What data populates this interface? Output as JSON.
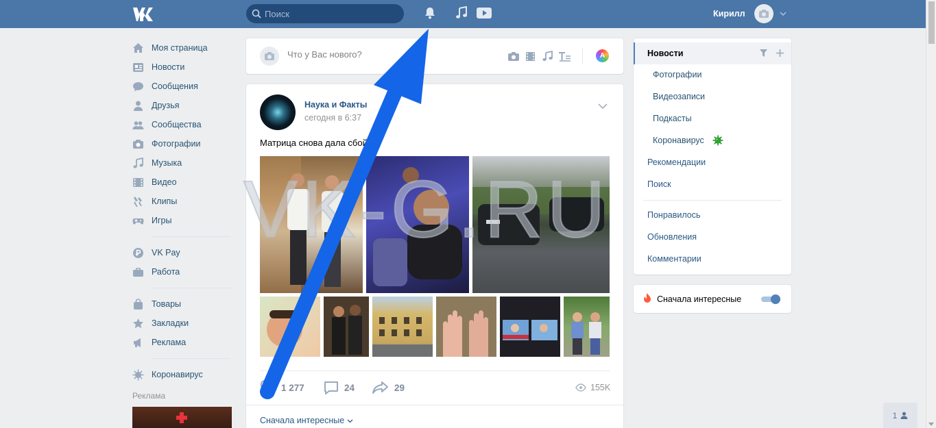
{
  "header": {
    "search_placeholder": "Поиск",
    "user_name": "Кирилл"
  },
  "leftnav": {
    "items": [
      {
        "label": "Моя страница",
        "icon": "home-icon"
      },
      {
        "label": "Новости",
        "icon": "news-icon"
      },
      {
        "label": "Сообщения",
        "icon": "messages-icon"
      },
      {
        "label": "Друзья",
        "icon": "friends-icon"
      },
      {
        "label": "Сообщества",
        "icon": "communities-icon"
      },
      {
        "label": "Фотографии",
        "icon": "photos-icon"
      },
      {
        "label": "Музыка",
        "icon": "music-icon"
      },
      {
        "label": "Видео",
        "icon": "video-icon"
      },
      {
        "label": "Клипы",
        "icon": "clips-icon"
      },
      {
        "label": "Игры",
        "icon": "games-icon"
      }
    ],
    "items2": [
      {
        "label": "VK Pay",
        "icon": "vkpay-icon"
      },
      {
        "label": "Работа",
        "icon": "work-icon"
      }
    ],
    "items3": [
      {
        "label": "Товары",
        "icon": "goods-icon"
      },
      {
        "label": "Закладки",
        "icon": "bookmarks-icon"
      },
      {
        "label": "Реклама",
        "icon": "ads-icon"
      }
    ],
    "items4": [
      {
        "label": "Коронавирус",
        "icon": "virus-icon"
      }
    ],
    "ads_label": "Реклама"
  },
  "composer": {
    "placeholder": "Что у Вас нового?"
  },
  "post": {
    "author": "Наука и Факты",
    "time": "сегодня в 6:37",
    "text": "Матрица снова дала сбой",
    "likes": "1 277",
    "comments": "24",
    "shares": "29",
    "views": "155K",
    "sort_label": "Сначала интересные"
  },
  "watermark": "VK-G.RU",
  "right_menu": {
    "title": "Новости",
    "subitems": [
      "Фотографии",
      "Видеозаписи",
      "Подкасты",
      "Коронавирус"
    ],
    "items": [
      "Рекомендации",
      "Поиск"
    ],
    "items2": [
      "Понравилось",
      "Обновления",
      "Комментарии"
    ]
  },
  "interesting_toggle": {
    "label": "Сначала интересные",
    "on": true
  },
  "friends_online": "1",
  "colors": {
    "header": "#4a76a8",
    "link": "#2a5885",
    "arrow": "#1565e8"
  }
}
